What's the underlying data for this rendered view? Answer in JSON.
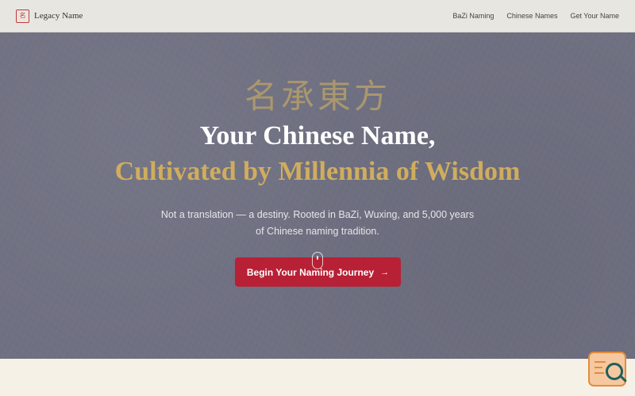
{
  "header": {
    "brand_name": "Legacy Name",
    "logo_seal_text": "名",
    "nav": [
      {
        "label": "BaZi Naming"
      },
      {
        "label": "Chinese Names"
      },
      {
        "label": "Get Your Name"
      }
    ]
  },
  "hero": {
    "cjk_heading": "名承東方",
    "title": "Your Chinese Name,",
    "subtitle": "Cultivated by Millennia of Wisdom",
    "description_line1": "Not a translation — a destiny. Rooted in BaZi, Wuxing, and 5,000 years",
    "description_line2": "of Chinese naming tradition.",
    "cta_label": "Begin Your Naming Journey",
    "cta_arrow": "→"
  },
  "colors": {
    "hero_bg": "#6f7081",
    "gold": "#d0ad5e",
    "cta": "#b82035",
    "seal_red": "#c23a3a"
  }
}
